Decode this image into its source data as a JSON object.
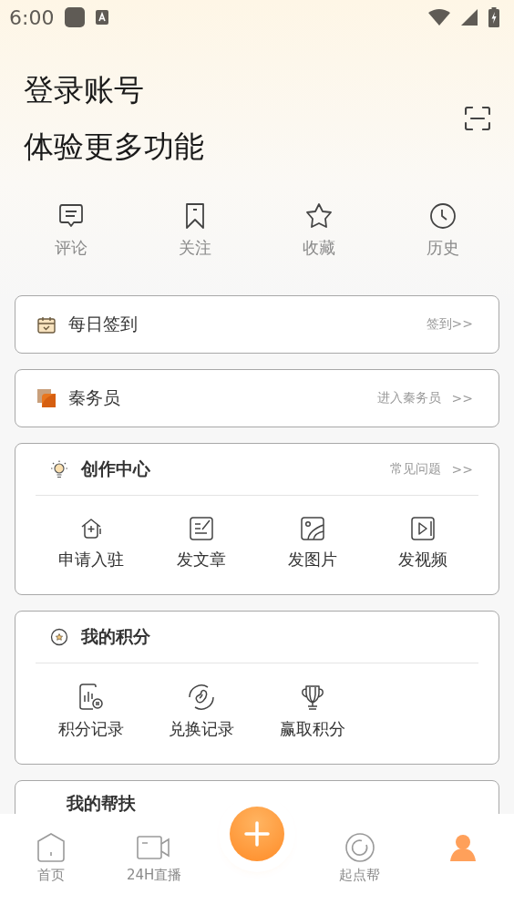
{
  "status_bar": {
    "time": "6:00"
  },
  "header": {
    "line_1": "登录账号",
    "line_2": "体验更多功能"
  },
  "quick_links": [
    {
      "kind": "comment",
      "label": "评论"
    },
    {
      "kind": "bookmark",
      "label": "关注"
    },
    {
      "kind": "star",
      "label": "收藏"
    },
    {
      "kind": "clock",
      "label": "历史"
    }
  ],
  "sign_in_card": {
    "title": "每日签到",
    "action": "签到>>"
  },
  "clerk_card": {
    "title": "秦务员",
    "action": "进入秦务员",
    "arrow": ">>"
  },
  "creation_center": {
    "title": "创作中心",
    "action": "常见问题",
    "arrow": ">>",
    "items": [
      {
        "kind": "house",
        "label": "申请入驻"
      },
      {
        "kind": "edit",
        "label": "发文章"
      },
      {
        "kind": "image",
        "label": "发图片"
      },
      {
        "kind": "video",
        "label": "发视频"
      }
    ]
  },
  "points": {
    "title": "我的积分",
    "items": [
      {
        "kind": "chart",
        "label": "积分记录"
      },
      {
        "kind": "bean",
        "label": "兑换记录"
      },
      {
        "kind": "trophy",
        "label": "赢取积分"
      }
    ]
  },
  "help_card": {
    "title": "我的帮扶"
  },
  "bottom_nav": [
    {
      "kind": "home",
      "label": "首页",
      "selected": false
    },
    {
      "kind": "live",
      "label": "24H直播",
      "selected": false
    },
    {
      "kind": "plus",
      "selected": false
    },
    {
      "kind": "help",
      "label": "起点帮",
      "selected": false
    },
    {
      "kind": "profile",
      "selected": true
    }
  ]
}
